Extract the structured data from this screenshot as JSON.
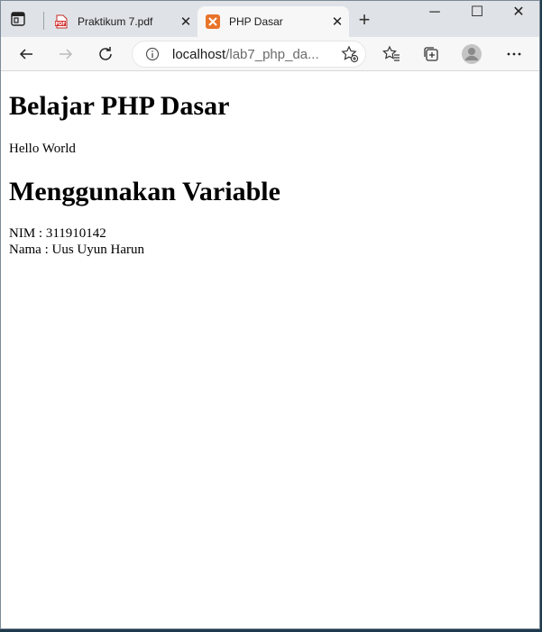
{
  "browser": {
    "tabs": [
      {
        "title": "Praktikum 7.pdf",
        "favicon": "pdf-icon",
        "active": false
      },
      {
        "title": "PHP Dasar",
        "favicon": "xampp-icon",
        "active": true
      }
    ],
    "new_tab": "+",
    "window_controls": {
      "minimize": "─",
      "maximize": "☐",
      "close": "✕"
    },
    "address": {
      "host": "localhost",
      "path": "/lab7_php_da..."
    }
  },
  "page": {
    "heading1": "Belajar PHP Dasar",
    "hello": "Hello World",
    "heading2": "Menggunakan Variable",
    "nim": "NIM : 311910142",
    "nama": "Nama : Uus Uyun Harun"
  },
  "colors": {
    "tabstrip": "#dfe3e7",
    "toolbar": "#f7f7f7",
    "pdf_red": "#d32f2f",
    "xampp_orange": "#e8742a"
  }
}
